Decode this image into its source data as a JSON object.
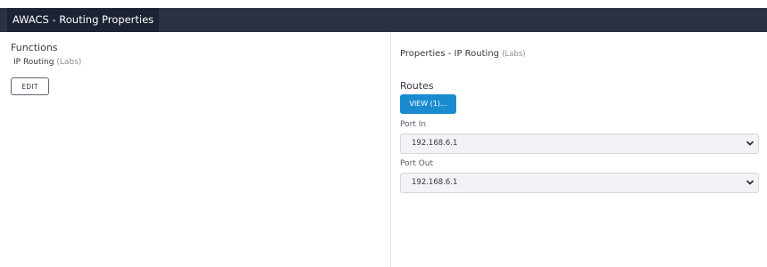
{
  "header": {
    "tab_title": "AWACS - Routing Properties"
  },
  "functions": {
    "title": "Functions",
    "item_name": "IP Routing",
    "item_tag": "(Labs)",
    "edit_label": "EDIT"
  },
  "properties": {
    "title_prefix": "Properties  - IP Routing",
    "title_tag": "(Labs)",
    "routes_label": "Routes",
    "view_button_label": "VIEW (1)...",
    "port_in": {
      "label": "Port In",
      "value": "192.168.6.1"
    },
    "port_out": {
      "label": "Port Out",
      "value": "192.168.6.1"
    }
  },
  "icons": {
    "select_indicator": "chevron-down-icon"
  }
}
